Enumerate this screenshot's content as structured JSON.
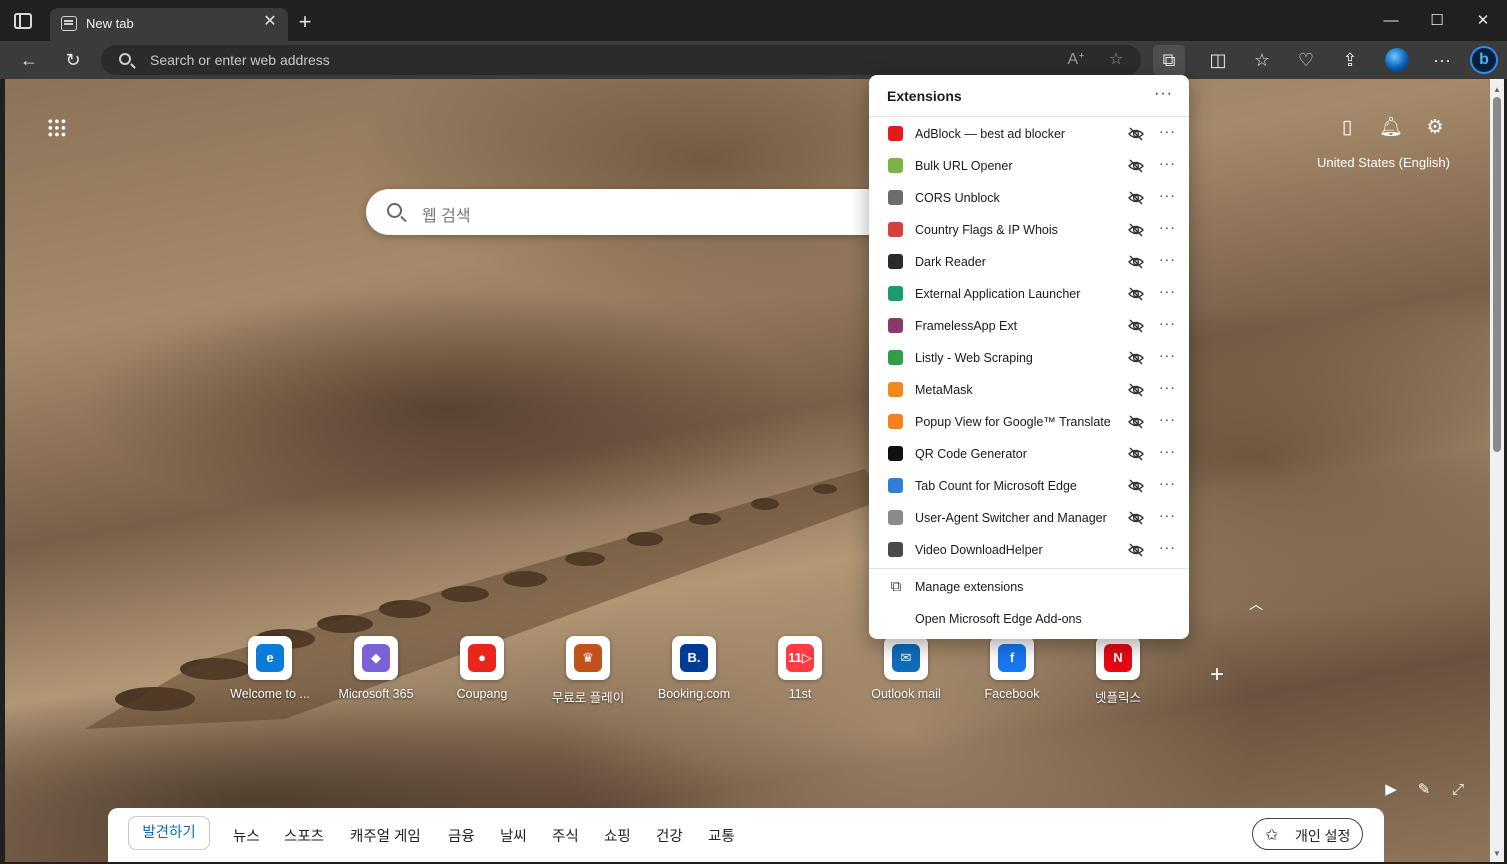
{
  "tab": {
    "title": "New tab"
  },
  "omnibox": {
    "placeholder": "Search or enter web address"
  },
  "ntp": {
    "region": "United States (English)",
    "search_placeholder": "웹 검색"
  },
  "quick_links": [
    {
      "label": "Welcome to ...",
      "color": "#0a7bd8",
      "glyph": "e"
    },
    {
      "label": "Microsoft 365",
      "color": "#7b61d6",
      "glyph": "◆"
    },
    {
      "label": "Coupang",
      "color": "#e8261e",
      "glyph": "●"
    },
    {
      "label": "무료로 플레이",
      "color": "#c0521c",
      "glyph": "♛"
    },
    {
      "label": "Booking.com",
      "color": "#003b95",
      "glyph": "B."
    },
    {
      "label": "11st",
      "color": "#ff3b44",
      "glyph": "11▷"
    },
    {
      "label": "Outlook mail",
      "color": "#0f6cbd",
      "glyph": "✉"
    },
    {
      "label": "Facebook",
      "color": "#1877f2",
      "glyph": "f"
    },
    {
      "label": "넷플릭스",
      "color": "#e50914",
      "glyph": "N"
    }
  ],
  "feed": {
    "active": "발견하기",
    "tabs": [
      "뉴스",
      "스포츠",
      "캐주얼 게임",
      "금융",
      "날씨",
      "주식",
      "쇼핑",
      "건강",
      "교통"
    ],
    "personalize": "개인 설정"
  },
  "extensions": {
    "title": "Extensions",
    "items": [
      {
        "name": "AdBlock — best ad blocker",
        "color": "#e31b1b"
      },
      {
        "name": "Bulk URL Opener",
        "color": "#7cb342"
      },
      {
        "name": "CORS Unblock",
        "color": "#6d6d6d"
      },
      {
        "name": "Country Flags & IP Whois",
        "color": "#d8403b"
      },
      {
        "name": "Dark Reader",
        "color": "#2b2b2b"
      },
      {
        "name": "External Application Launcher",
        "color": "#1a9c6f"
      },
      {
        "name": "FramelessApp Ext",
        "color": "#8a3a6a"
      },
      {
        "name": "Listly - Web Scraping",
        "color": "#2e9e48"
      },
      {
        "name": "MetaMask",
        "color": "#f28a1b"
      },
      {
        "name": "Popup View for Google™ Translate",
        "color": "#f5821f"
      },
      {
        "name": "QR Code Generator",
        "color": "#111111"
      },
      {
        "name": "Tab Count for Microsoft Edge",
        "color": "#2f7fd6"
      },
      {
        "name": "User-Agent Switcher and Manager",
        "color": "#8a8a8a"
      },
      {
        "name": "Video DownloadHelper",
        "color": "#4a4a4a"
      }
    ],
    "manage": "Manage extensions",
    "addons": "Open Microsoft Edge Add-ons"
  }
}
